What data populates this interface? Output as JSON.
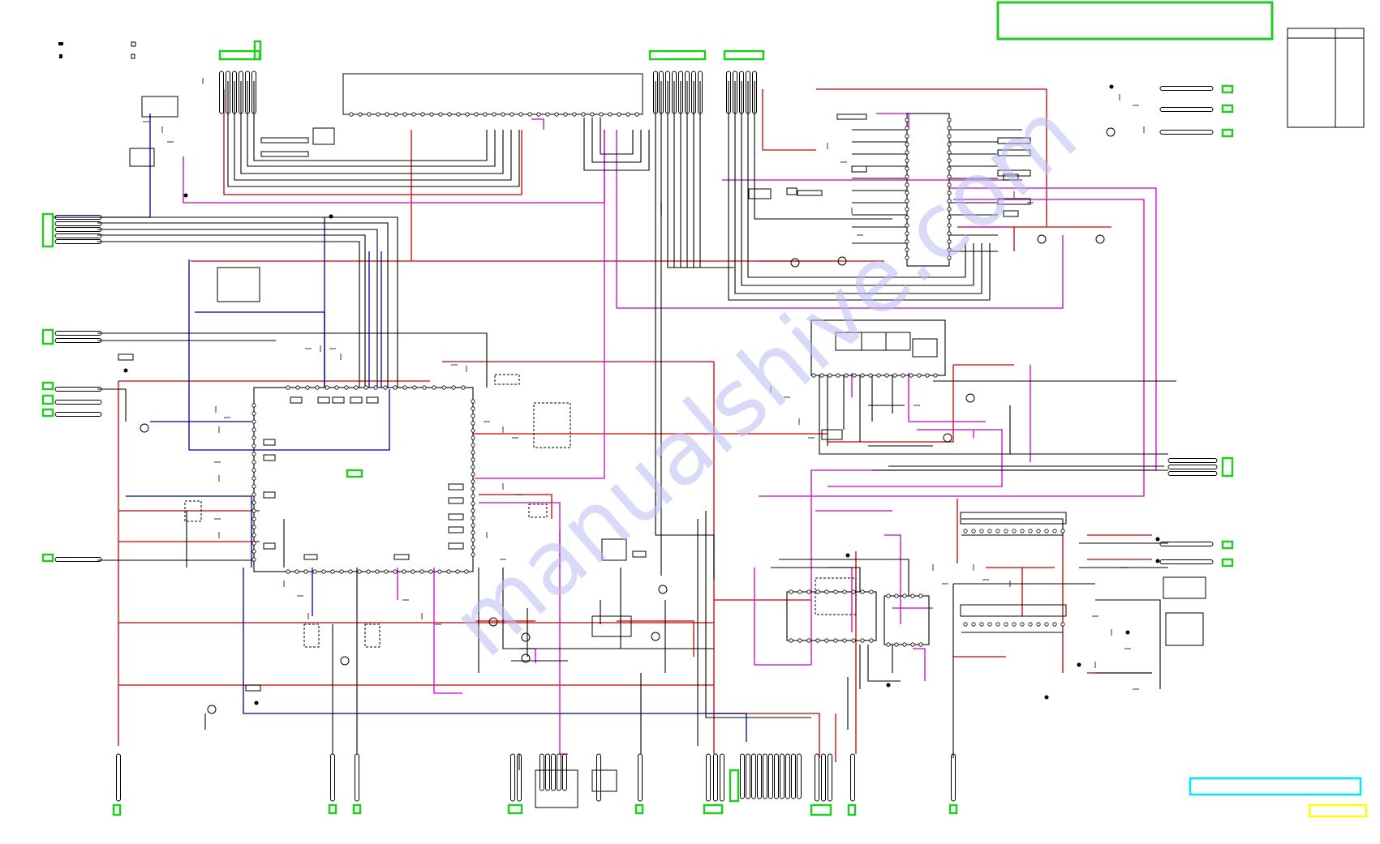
{
  "watermark": {
    "text": "manualshive.com",
    "color": "#b9b9f2"
  },
  "colors": {
    "wire_black": "#000000",
    "wire_red": "#cc0000",
    "wire_blue": "#000099",
    "wire_magenta": "#cc00cc",
    "connector_green": "#22cc22",
    "legend_cyan": "#00e5ff",
    "legend_yellow": "#ffff00"
  }
}
